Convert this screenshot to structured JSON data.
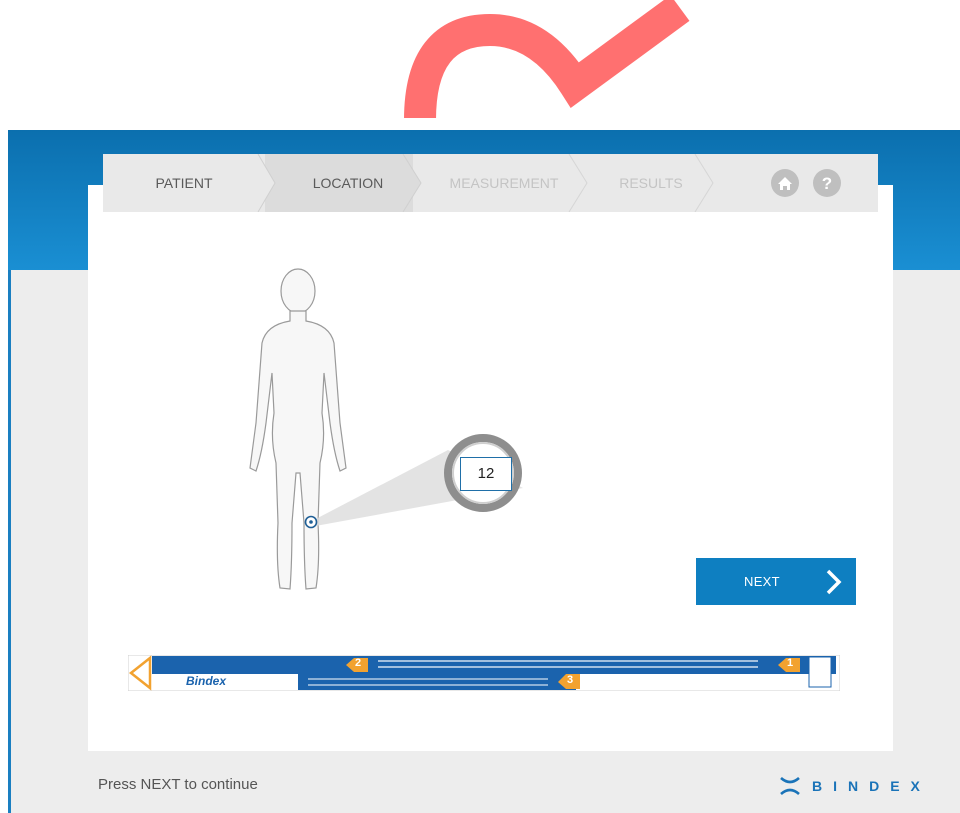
{
  "steps": [
    {
      "label": "PATIENT",
      "state": "done"
    },
    {
      "label": "LOCATION",
      "state": "active"
    },
    {
      "label": "MEASUREMENT",
      "state": "disabled"
    },
    {
      "label": "RESULTS",
      "state": "disabled"
    }
  ],
  "icons": {
    "home": "home-icon",
    "help": "help-icon"
  },
  "measurement": {
    "value": "12"
  },
  "next_button": {
    "label": "NEXT"
  },
  "footer": {
    "hint": "Press NEXT to continue",
    "brand": "BINDEX"
  },
  "tape": {
    "brand_text": "Bindex",
    "markers": [
      "1",
      "2",
      "3"
    ]
  },
  "colors": {
    "accent": "#0e7fc1",
    "banner": "#0b6fae",
    "marker": "#f5a623",
    "logo_mark": "#ff7070"
  }
}
